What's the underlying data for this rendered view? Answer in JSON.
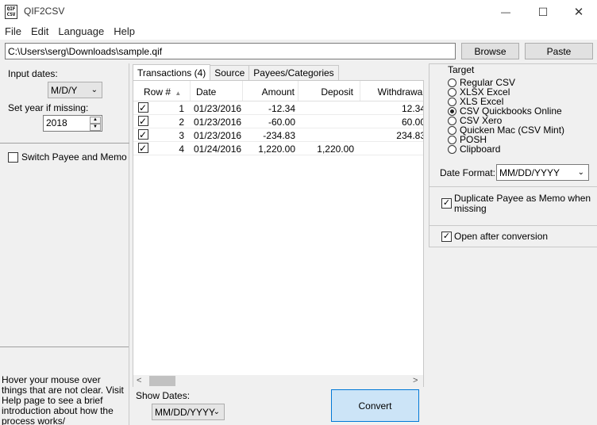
{
  "window": {
    "icon_text": "QIF\nCSV",
    "title": "QIF2CSV",
    "minimize_glyph": "—",
    "maximize_glyph": "☐",
    "close_glyph": "✕"
  },
  "menu": [
    "File",
    "Edit",
    "Language",
    "Help"
  ],
  "file_path": "C:\\Users\\serg\\Downloads\\sample.qif",
  "buttons": {
    "browse": "Browse",
    "paste": "Paste",
    "convert": "Convert"
  },
  "left": {
    "input_dates_label": "Input dates:",
    "input_dates_value": "M/D/Y",
    "year_label": "Set year if missing:",
    "year_value": "2018",
    "switch_label": "Switch Payee and Memo",
    "switch_checked": false,
    "hint": "Hover your mouse over things that are not clear. Visit Help page to see a brief introduction about how the process works/"
  },
  "tabs": [
    "Transactions (4)",
    "Source",
    "Payees/Categories"
  ],
  "table": {
    "headers": [
      "",
      "Row #",
      "Date",
      "Amount",
      "Deposit",
      "Withdrawal"
    ],
    "sort_glyph": "▲",
    "rows": [
      {
        "checked": true,
        "row": "1",
        "date": "01/23/2016",
        "amount": "-12.34",
        "deposit": "",
        "withdrawal": "12.34"
      },
      {
        "checked": true,
        "row": "2",
        "date": "01/23/2016",
        "amount": "-60.00",
        "deposit": "",
        "withdrawal": "60.00"
      },
      {
        "checked": true,
        "row": "3",
        "date": "01/23/2016",
        "amount": "-234.83",
        "deposit": "",
        "withdrawal": "234.83"
      },
      {
        "checked": true,
        "row": "4",
        "date": "01/24/2016",
        "amount": "1,220.00",
        "deposit": "1,220.00",
        "withdrawal": ""
      }
    ]
  },
  "show_dates": {
    "label": "Show Dates:",
    "value": "MM/DD/YYYY"
  },
  "target": {
    "label": "Target",
    "options": [
      "Regular CSV",
      "XLSX Excel",
      "XLS Excel",
      "CSV Quickbooks Online",
      "CSV Xero",
      "Quicken Mac (CSV Mint)",
      "POSH",
      "Clipboard"
    ],
    "selected_index": 3,
    "date_format_label": "Date Format:",
    "date_format_value": "MM/DD/YYYY"
  },
  "options": {
    "duplicate_payee_label": "Duplicate Payee as Memo when missing",
    "duplicate_payee_checked": true,
    "open_after_label": "Open after conversion",
    "open_after_checked": true
  },
  "glyphs": {
    "check": "✓",
    "chevron": "⌄",
    "spin_up": "▲",
    "spin_down": "▼",
    "scroll_left": "<",
    "scroll_right": ">"
  }
}
